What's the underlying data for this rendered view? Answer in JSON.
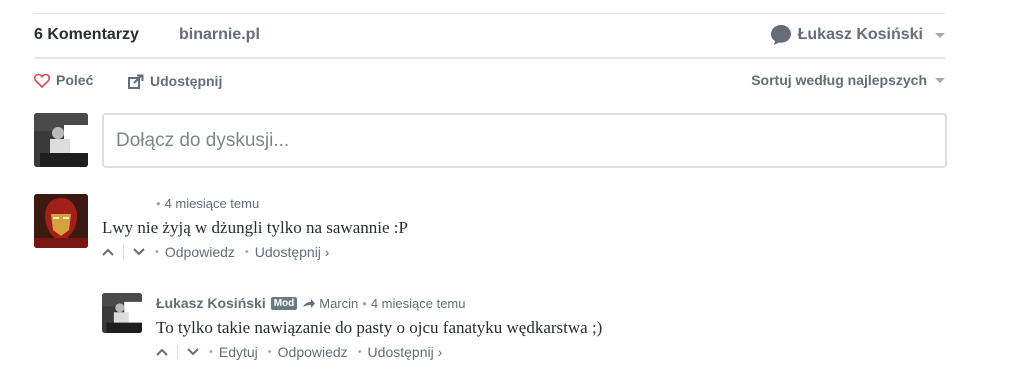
{
  "nav": {
    "comments_tab": "6 Komentarzy",
    "site_tab": "binarnie.pl",
    "user_name": "Łukasz Kosiński"
  },
  "actions": {
    "recommend": "Poleć",
    "share": "Udostępnij",
    "sort": "Sortuj według najlepszych"
  },
  "compose": {
    "placeholder": "Dołącz do dyskusji..."
  },
  "comments": [
    {
      "time": "4 miesiące temu",
      "text": "Lwy nie żyją w dżungli tylko na sawannie :P",
      "reply": "Odpowiedz",
      "share": "Udostępnij ›"
    },
    {
      "author": "Łukasz Kosiński",
      "badge": "Mod",
      "reply_to": "Marcin",
      "time": "4 miesiące temu",
      "text": "To tylko takie nawiązanie do pasty o ojcu fanatyku wędkarstwa ;)",
      "edit": "Edytuj",
      "reply": "Odpowiedz",
      "share": "Udostępnij ›"
    }
  ],
  "colors": {
    "accent": "#2e9fff",
    "heart": "#e0455a",
    "muted": "#656c7a"
  }
}
